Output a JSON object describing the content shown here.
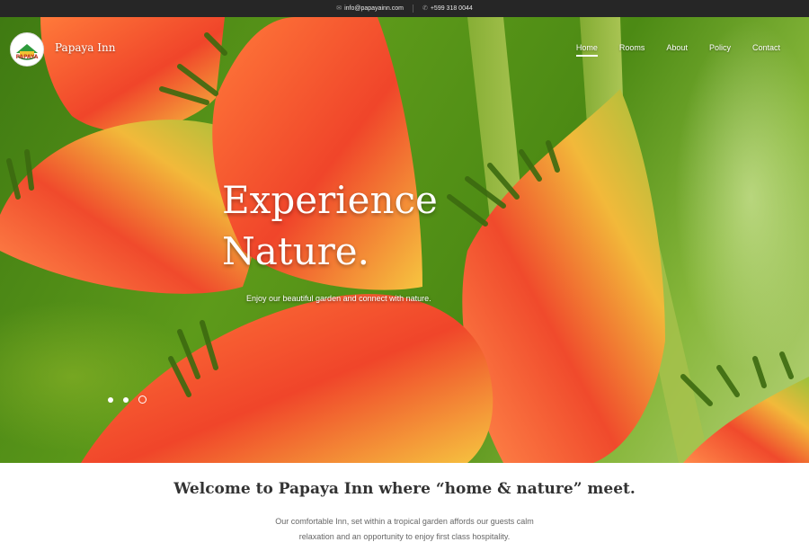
{
  "topbar": {
    "email": "info@papayainn.com",
    "phone": "+599 318 0044",
    "email_icon": "envelope-icon",
    "phone_icon": "phone-icon"
  },
  "header": {
    "logo_text": "PAPAYA",
    "brand": "Papaya Inn",
    "nav": [
      {
        "label": "Home",
        "active": true
      },
      {
        "label": "Rooms"
      },
      {
        "label": "About"
      },
      {
        "label": "Policy"
      },
      {
        "label": "Contact"
      }
    ]
  },
  "hero": {
    "headline_line1": "Experience",
    "headline_line2": "Nature.",
    "subtext": "Enjoy our beautiful garden and connect with nature.",
    "slides": 3,
    "active_slide": 3
  },
  "welcome": {
    "title": "Welcome to Papaya Inn where “home & nature” meet.",
    "line1": "Our comfortable Inn, set within a tropical garden affords our guests calm",
    "line2": "relaxation and an opportunity to enjoy first class hospitality."
  },
  "colors": {
    "topbar": "#262626",
    "flower": "#f0502f",
    "leaf": "#4c8a14"
  }
}
